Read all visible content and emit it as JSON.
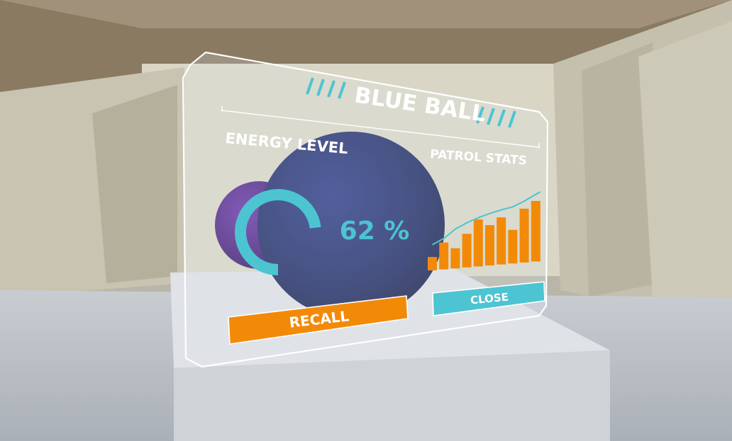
{
  "panel": {
    "title": "BLUE BALL",
    "energy": {
      "heading": "ENERGY LEVEL",
      "percent_label": "62 %",
      "level": 62
    },
    "patrol": {
      "heading": "PATROL STATS",
      "bars": [
        2,
        4,
        3,
        5,
        7,
        6,
        7,
        5,
        8,
        9
      ],
      "trend": [
        2.2,
        3.2,
        4.8,
        5.8,
        6.6,
        7.2,
        7.7,
        8.1,
        9.0,
        10.6
      ]
    },
    "recall_label": "RECALL",
    "close_label": "CLOSE"
  },
  "colors": {
    "accent_cyan": "#4cc4d2",
    "accent_orange": "#f28a08",
    "ball_blue": "#1e2a66",
    "ball_purple": "#4a2280"
  }
}
